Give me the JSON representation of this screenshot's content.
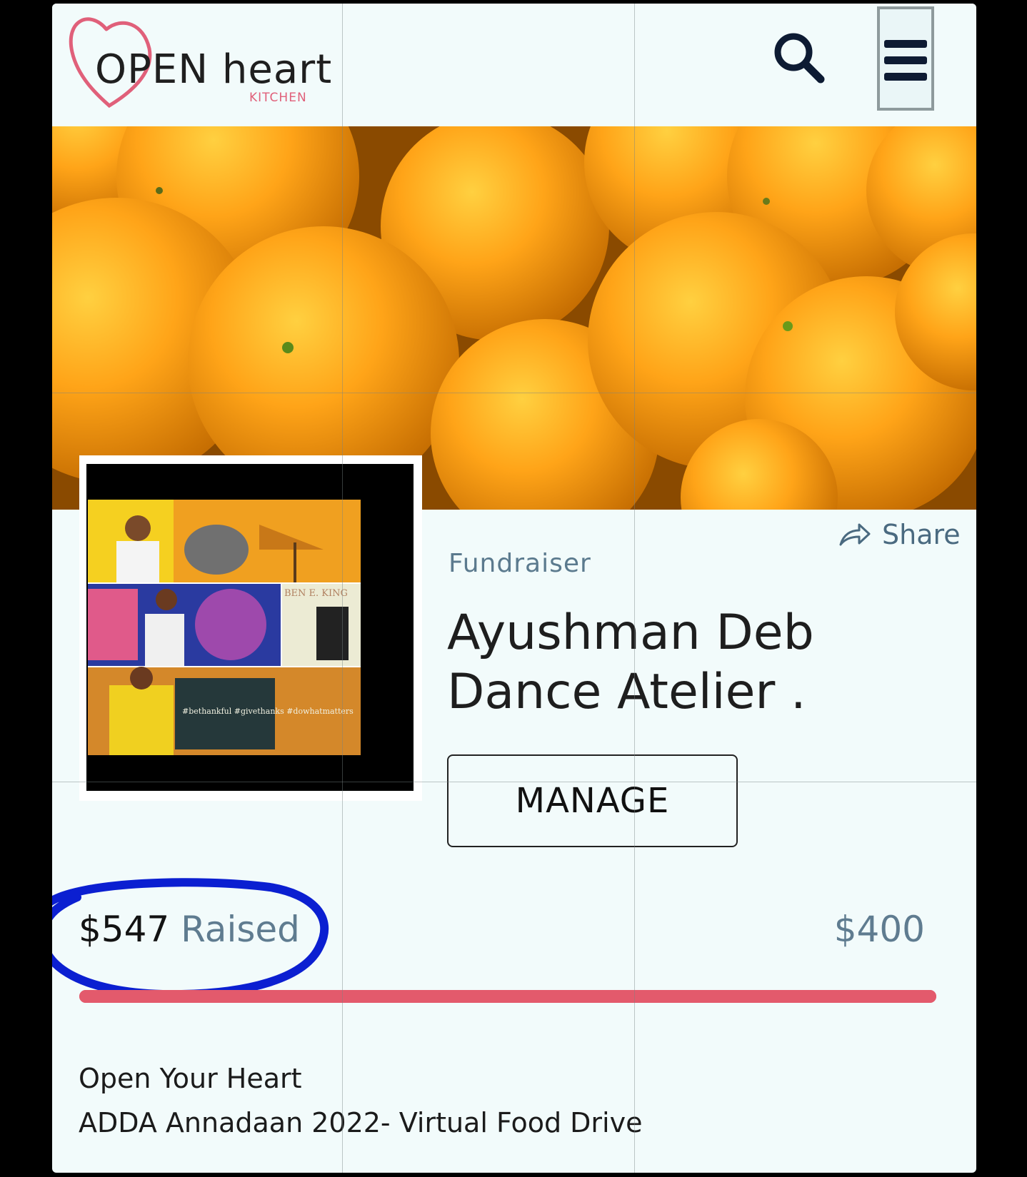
{
  "header": {
    "logo_text": "OPEN heart",
    "logo_sub": "KITCHEN",
    "search_icon": "search-icon",
    "menu_icon": "hamburger-menu-icon"
  },
  "hero": {
    "image": "oranges-photo"
  },
  "campaign": {
    "share_label": "Share",
    "kicker": "Fundraiser",
    "title": "Ayushman Deb Dance Atelier .",
    "manage_label": "MANAGE",
    "raised_amount": "$547",
    "raised_label": "Raised",
    "goal": "$400",
    "progress_fraction": 1.0,
    "description_line1": "Open Your Heart",
    "description_line2": "ADDA Annadaan 2022- Virtual Food Drive"
  },
  "thumb": {
    "tagline": "#bethankful #givethanks #dowhatmatters",
    "album_label": "BEN E. KING"
  },
  "colors": {
    "background": "#f2fbfb",
    "progress": "#e35a6c",
    "heading": "#1e1e1e",
    "muted": "#5f7c90",
    "annotation": "#0b1fd1",
    "logo_pink": "#e0607a"
  }
}
